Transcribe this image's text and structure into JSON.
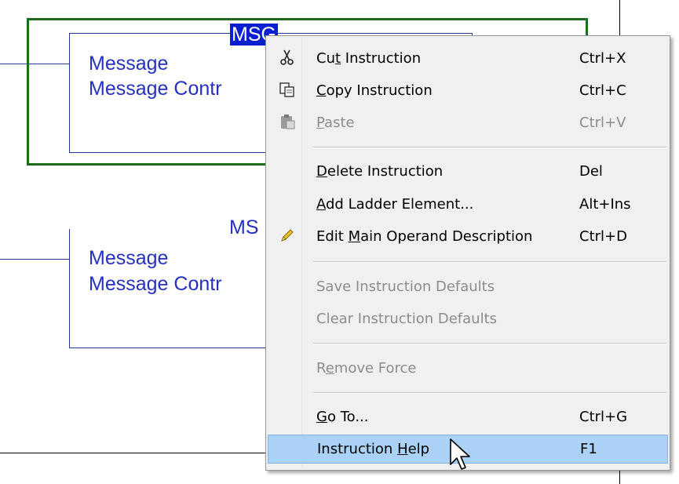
{
  "ladder": {
    "rung1": {
      "title": "MSG",
      "title_selected": true,
      "line1": "Message",
      "line2": "Message Contr"
    },
    "rung2": {
      "title": "MS",
      "line1": "Message",
      "line2": "Message Contr"
    },
    "colors": {
      "selection_border": "#1e6b1e",
      "instruction_text": "#2430c0",
      "selection_bg": "#0a1fd0"
    }
  },
  "context_menu": {
    "items": [
      {
        "icon": "scissors-icon",
        "label_pre": "Cu",
        "label_ul": "t",
        "label_post": " Instruction",
        "shortcut": "Ctrl+X",
        "disabled": false
      },
      {
        "icon": "copy-icon",
        "label_pre": "",
        "label_ul": "C",
        "label_post": "opy Instruction",
        "shortcut": "Ctrl+C",
        "disabled": false
      },
      {
        "icon": "paste-icon",
        "label_pre": "",
        "label_ul": "P",
        "label_post": "aste",
        "shortcut": "Ctrl+V",
        "disabled": true
      },
      {
        "icon": "",
        "label_pre": "",
        "label_ul": "D",
        "label_post": "elete Instruction",
        "shortcut": "Del",
        "disabled": false
      },
      {
        "icon": "",
        "label_pre": "",
        "label_ul": "A",
        "label_post": "dd Ladder Element...",
        "shortcut": "Alt+Ins",
        "disabled": false
      },
      {
        "icon": "pencil-icon",
        "label_pre": "Edit ",
        "label_ul": "M",
        "label_post": "ain Operand Description",
        "shortcut": "Ctrl+D",
        "disabled": false
      },
      {
        "icon": "",
        "label_pre": "Save Instruction Defaults",
        "label_ul": "",
        "label_post": "",
        "shortcut": "",
        "disabled": true
      },
      {
        "icon": "",
        "label_pre": "Clear Instruction Defaults",
        "label_ul": "",
        "label_post": "",
        "shortcut": "",
        "disabled": true
      },
      {
        "icon": "",
        "label_pre": "R",
        "label_ul": "e",
        "label_post": "move Force",
        "shortcut": "",
        "disabled": true
      },
      {
        "icon": "",
        "label_pre": "",
        "label_ul": "G",
        "label_post": "o To...",
        "shortcut": "Ctrl+G",
        "disabled": false
      },
      {
        "icon": "",
        "label_pre": "Instruction ",
        "label_ul": "H",
        "label_post": "elp",
        "shortcut": "F1",
        "disabled": false,
        "highlighted": true
      }
    ],
    "colors": {
      "highlight": "#aad2f7",
      "disabled_text": "#8c8c8c",
      "background": "#f0f0f0"
    }
  }
}
